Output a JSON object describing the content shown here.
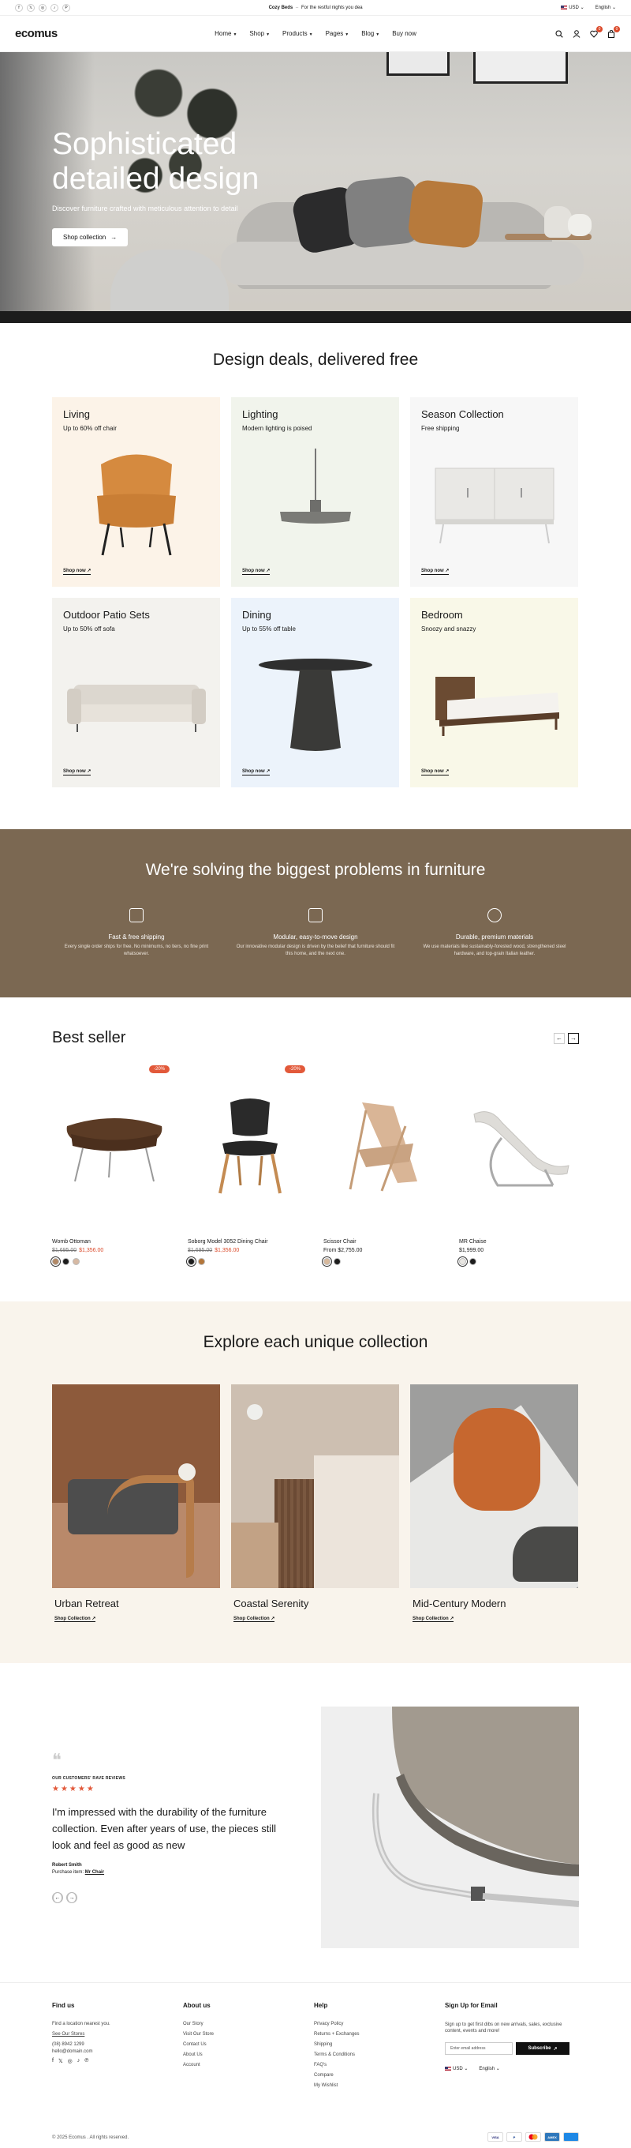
{
  "topbar": {
    "socials": [
      "f",
      "𝕏",
      "◎",
      "♪",
      "P"
    ],
    "promo_bold": "Cozy Beds",
    "promo_sep": "–",
    "promo_text": "For the restful nights you dea",
    "currency": "USD",
    "language": "English"
  },
  "header": {
    "logo": "ecomus",
    "nav": [
      {
        "label": "Home",
        "dropdown": true
      },
      {
        "label": "Shop",
        "dropdown": true
      },
      {
        "label": "Products",
        "dropdown": true
      },
      {
        "label": "Pages",
        "dropdown": true
      },
      {
        "label": "Blog",
        "dropdown": true
      },
      {
        "label": "Buy now",
        "dropdown": false
      }
    ],
    "wishlist_count": "0",
    "cart_count": "0"
  },
  "hero": {
    "title": "Sophisticated detailed design",
    "subtitle": "Discover furniture crafted with meticulous attention to detail",
    "button": "Shop collection"
  },
  "deals": {
    "title": "Design deals, delivered free",
    "items": [
      {
        "title": "Living",
        "sub": "Up to 60% off chair",
        "link": "Shop now",
        "bg": "#fcf3e8"
      },
      {
        "title": "Lighting",
        "sub": "Modern lighting is poised",
        "link": "Shop now",
        "bg": "#f1f4ec"
      },
      {
        "title": "Season Collection",
        "sub": "Free shipping",
        "link": "Shop now",
        "bg": "#f7f7f7"
      },
      {
        "title": "Outdoor Patio Sets",
        "sub": "Up to 50% off sofa",
        "link": "Shop now",
        "bg": "#f3f2ee"
      },
      {
        "title": "Dining",
        "sub": "Up to 55% off table",
        "link": "Shop now",
        "bg": "#ecf3fb"
      },
      {
        "title": "Bedroom",
        "sub": "Snoozy and snazzy",
        "link": "Shop now",
        "bg": "#f9f8e8"
      }
    ]
  },
  "problems": {
    "title": "We're solving the biggest problems in furniture",
    "features": [
      {
        "title": "Fast & free shipping",
        "text": "Every single order ships for free. No minimums, no tiers, no fine print whatsoever."
      },
      {
        "title": "Modular, easy-to-move design",
        "text": "Our innovative modular design is driven by the belief that furniture should fit this home, and the next one."
      },
      {
        "title": "Durable, premium materials",
        "text": "We use materials like sustainably-forested wood, strengthened steel hardware, and top-grain Italian leather."
      }
    ]
  },
  "bestseller": {
    "title": "Best seller",
    "products": [
      {
        "name": "Womb Ottoman",
        "old_price": "$1,695.00",
        "price": "$1,356.00",
        "badge": "-20%",
        "swatches": [
          "#b38a67",
          "#1d1d1d",
          "#d6b9a3"
        ]
      },
      {
        "name": "Soborg Model 3052 Dining Chair",
        "old_price": "$1,695.00",
        "price": "$1,356.00",
        "badge": "-20%",
        "swatches": [
          "#1d1d1d",
          "#b3763a"
        ]
      },
      {
        "name": "Scissor Chair",
        "old_price": "",
        "price": "From $2,755.00",
        "badge": "",
        "swatches": [
          "#d8b99c",
          "#1d1d1d"
        ]
      },
      {
        "name": "MR Chaise",
        "old_price": "",
        "price": "$1,999.00",
        "badge": "",
        "swatches": [
          "#e8e6e2",
          "#1d1d1d"
        ]
      }
    ]
  },
  "collections": {
    "title": "Explore each unique collection",
    "items": [
      {
        "title": "Urban Retreat",
        "link": "Shop Collection"
      },
      {
        "title": "Coastal Serenity",
        "link": "Shop Collection"
      },
      {
        "title": "Mid-Century Modern",
        "link": "Shop Collection"
      }
    ]
  },
  "testimonial": {
    "label": "OUR CUSTOMERS' RAVE REVIEWS",
    "stars": "★★★★★",
    "quote": "I'm impressed with the durability of the furniture collection. Even after years of use, the pieces still look and feel as good as new",
    "author": "Robert Smith",
    "purchase_label": "Purchase item:",
    "purchase_item": "Mr Chair"
  },
  "footer": {
    "find_us": {
      "title": "Find us",
      "text": "Find a location nearest you.",
      "link": "See Our Stores",
      "phone": "(08) 8942 1299",
      "email": "hello@domain.com"
    },
    "about": {
      "title": "About us",
      "links": [
        "Our Story",
        "Visit Our Store",
        "Contact Us",
        "About Us",
        "Account"
      ]
    },
    "help": {
      "title": "Help",
      "links": [
        "Privacy Policy",
        "Returns + Exchanges",
        "Shipping",
        "Terms & Conditions",
        "FAQ's",
        "Compare",
        "My Wishlist"
      ]
    },
    "signup": {
      "title": "Sign Up for Email",
      "text": "Sign up to get first dibs on new arrivals, sales, exclusive content, events and more!",
      "placeholder": "Enter email address",
      "button": "Subscribe",
      "currency": "USD",
      "language": "English"
    },
    "copyright": "© 2025 Ecomus . All rights reserved.",
    "payments": [
      "VISA",
      "P",
      "MC",
      "AMEX",
      "CARD"
    ]
  }
}
